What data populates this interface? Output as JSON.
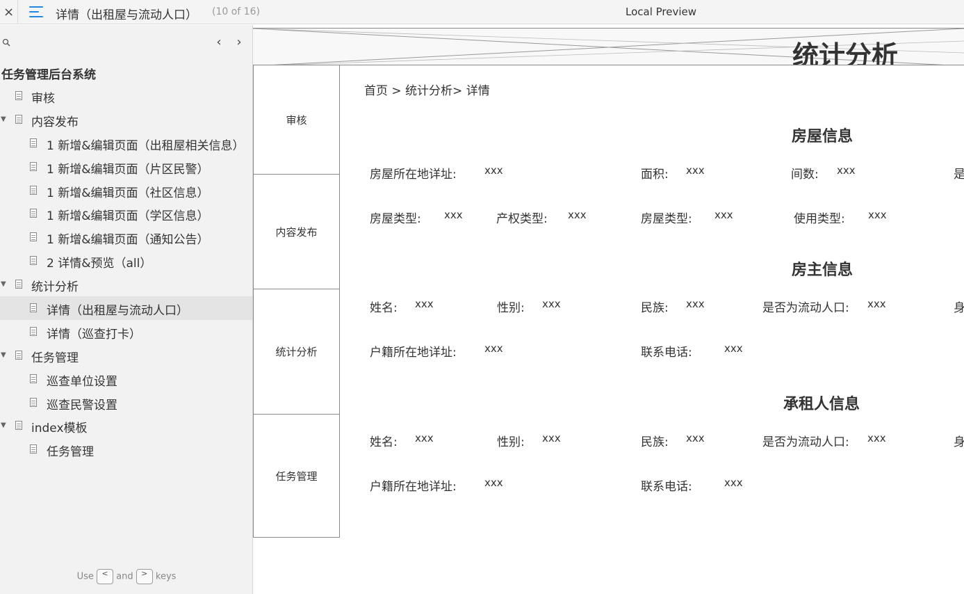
{
  "topbar": {
    "close_label": "×",
    "page_title": "详情（出租屋与流动人口）",
    "page_count": "(10 of 16)",
    "preview_title": "Local Preview"
  },
  "sidebar": {
    "prev_label": "‹",
    "next_label": "›",
    "root": "任务管理后台系统",
    "items": [
      {
        "label": "审核",
        "level": 1,
        "caret": false
      },
      {
        "label": "内容发布",
        "level": 1,
        "caret": true
      },
      {
        "label": "1 新增&编辑页面（出租屋相关信息）",
        "level": 2,
        "caret": false
      },
      {
        "label": "1 新增&编辑页面（片区民警）",
        "level": 2,
        "caret": false
      },
      {
        "label": "1 新增&编辑页面（社区信息）",
        "level": 2,
        "caret": false
      },
      {
        "label": "1 新增&编辑页面（学区信息）",
        "level": 2,
        "caret": false
      },
      {
        "label": "1 新增&编辑页面（通知公告）",
        "level": 2,
        "caret": false
      },
      {
        "label": "2 详情&预览（all）",
        "level": 2,
        "caret": false
      },
      {
        "label": "统计分析",
        "level": 1,
        "caret": true
      },
      {
        "label": "详情（出租屋与流动人口）",
        "level": 2,
        "caret": false,
        "selected": true
      },
      {
        "label": "详情（巡查打卡）",
        "level": 2,
        "caret": false
      },
      {
        "label": "任务管理",
        "level": 1,
        "caret": true
      },
      {
        "label": "巡查单位设置",
        "level": 2,
        "caret": false
      },
      {
        "label": "巡查民警设置",
        "level": 2,
        "caret": false
      },
      {
        "label": "index模板",
        "level": 1,
        "caret": true
      },
      {
        "label": "任务管理",
        "level": 2,
        "caret": false
      }
    ],
    "hint": {
      "use": "Use",
      "and": "and",
      "keys": "keys",
      "key1": "<",
      "key2": ">"
    }
  },
  "content": {
    "banner_title": "统计分析",
    "nav": [
      "审核",
      "内容发布",
      "统计分析",
      "任务管理"
    ],
    "breadcrumb": "首页 > 统计分析> 详情",
    "sections": {
      "house": "房屋信息",
      "owner": "房主信息",
      "tenant": "承租人信息"
    },
    "house_fields": {
      "address_label": "房屋所在地详址:",
      "address_value": "xxx",
      "area_label": "面积:",
      "area_value": "xxx",
      "rooms_label": "间数:",
      "rooms_value": "xxx",
      "cut1": "是",
      "type_label": "房屋类型:",
      "type_value": "xxx",
      "property_label": "产权类型:",
      "property_value": "xxx",
      "type2_label": "房屋类型:",
      "type2_value": "xxx",
      "usage_label": "使用类型:",
      "usage_value": "xxx"
    },
    "owner_fields": {
      "name_label": "姓名:",
      "name_value": "xxx",
      "gender_label": "性别:",
      "gender_value": "xxx",
      "ethnic_label": "民族:",
      "ethnic_value": "xxx",
      "floating_label": "是否为流动人口:",
      "floating_value": "xxx",
      "cut": "身",
      "household_label": "户籍所在地详址:",
      "household_value": "xxx",
      "phone_label": "联系电话:",
      "phone_value": "xxx"
    },
    "tenant_fields": {
      "name_label": "姓名:",
      "name_value": "xxx",
      "gender_label": "性别:",
      "gender_value": "xxx",
      "ethnic_label": "民族:",
      "ethnic_value": "xxx",
      "floating_label": "是否为流动人口:",
      "floating_value": "xxx",
      "cut": "身",
      "household_label": "户籍所在地详址:",
      "household_value": "xxx",
      "phone_label": "联系电话:",
      "phone_value": "xxx"
    }
  }
}
